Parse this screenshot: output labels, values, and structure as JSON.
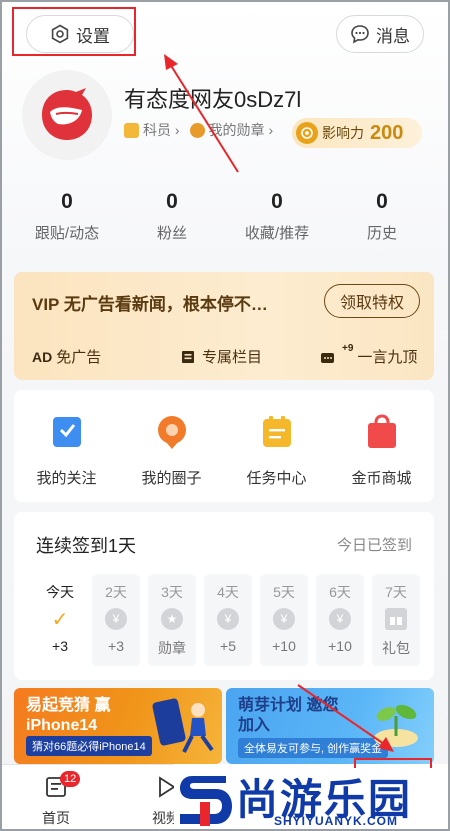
{
  "topbar": {
    "settings_label": "设置",
    "messages_label": "消息"
  },
  "profile": {
    "username": "有态度网友0sDz7l",
    "rank": "科员",
    "medals": "我的勋章",
    "influence_label": "影响力",
    "influence_value": "200"
  },
  "stats": [
    {
      "num": "0",
      "label": "跟贴/动态"
    },
    {
      "num": "0",
      "label": "粉丝"
    },
    {
      "num": "0",
      "label": "收藏/推荐"
    },
    {
      "num": "0",
      "label": "历史"
    }
  ],
  "vip": {
    "title": "VIP 无广告看新闻，根本停不…",
    "button": "领取特权",
    "features": [
      {
        "icon": "AD",
        "label": "免广告"
      },
      {
        "icon": "column-icon",
        "label": "专属栏目"
      },
      {
        "icon": "+9",
        "label": "一言九顶"
      }
    ]
  },
  "grid": [
    {
      "label": "我的关注",
      "color": "#3d8ef0"
    },
    {
      "label": "我的圈子",
      "color": "#f27b2b"
    },
    {
      "label": "任务中心",
      "color": "#f5b82a"
    },
    {
      "label": "金币商城",
      "color": "#f04a4a"
    }
  ],
  "signin": {
    "title": "连续签到1天",
    "status": "今日已签到",
    "days": [
      {
        "label": "今天",
        "reward": "+3",
        "icon": "✓"
      },
      {
        "label": "2天",
        "reward": "+3",
        "icon": "¥"
      },
      {
        "label": "3天",
        "reward": "勋章",
        "icon": "★"
      },
      {
        "label": "4天",
        "reward": "+5",
        "icon": "¥"
      },
      {
        "label": "5天",
        "reward": "+10",
        "icon": "¥"
      },
      {
        "label": "6天",
        "reward": "+10",
        "icon": "¥"
      },
      {
        "label": "7天",
        "reward": "礼包",
        "icon": "gift"
      }
    ]
  },
  "banners": [
    {
      "title": "易起竞猜 赢iPhone14",
      "sub": "猜对66题必得iPhone14"
    },
    {
      "title": "萌芽计划 邀您加入",
      "sub": "全体易友可参与, 创作赢奖金"
    }
  ],
  "bottomnav": [
    {
      "label": "首页",
      "badge": "12"
    },
    {
      "label": "视频"
    }
  ],
  "watermark": {
    "text": "尚游乐园",
    "url": "SHYIYUANYK.COM"
  },
  "colors": {
    "accent_red": "#e8262b",
    "vip_bg": "#fbe4bf",
    "influence": "#c88a10"
  }
}
